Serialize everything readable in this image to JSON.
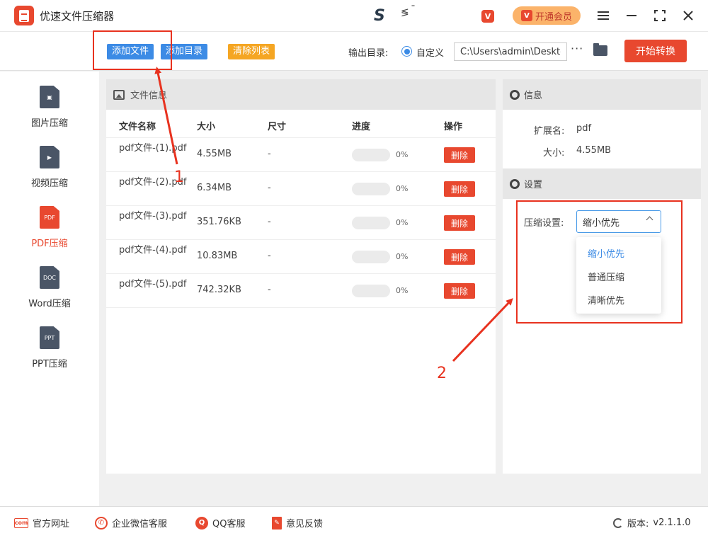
{
  "app": {
    "title": "优速文件压缩器",
    "vip_label": "开通会员",
    "vip_badge": "V",
    "window_controls": [
      "menu-icon",
      "minimize-icon",
      "fullscreen-icon",
      "close-icon"
    ],
    "mid_icons": {
      "s": "S",
      "a": "≶",
      "b": "¯"
    }
  },
  "toolbar": {
    "add_file": "添加文件",
    "add_dir": "添加目录",
    "clear_list": "清除列表",
    "output_label": "输出目录:",
    "radio_label": "自定义",
    "output_path": "C:\\Users\\admin\\Desktop",
    "more": "···",
    "start": "开始转换"
  },
  "sidebar": {
    "items": [
      {
        "label": "图片压缩",
        "icon": "image-icon",
        "glyph": "▣",
        "active": false
      },
      {
        "label": "视频压缩",
        "icon": "video-icon",
        "glyph": "▶",
        "active": false
      },
      {
        "label": "PDF压缩",
        "icon": "pdf-icon",
        "glyph": "PDF",
        "active": true
      },
      {
        "label": "Word压缩",
        "icon": "doc-icon",
        "glyph": "DOC",
        "active": false
      },
      {
        "label": "PPT压缩",
        "icon": "ppt-icon",
        "glyph": "PPT",
        "active": false
      }
    ]
  },
  "file_panel": {
    "title": "文件信息",
    "columns": [
      "文件名称",
      "大小",
      "尺寸",
      "进度",
      "操作"
    ],
    "rows": [
      {
        "name": "pdf文件-(1).pdf",
        "size": "4.55MB",
        "dim": "-",
        "progress": 0,
        "progress_text": "0%",
        "action": "删除"
      },
      {
        "name": "pdf文件-(2).pdf",
        "size": "6.34MB",
        "dim": "-",
        "progress": 0,
        "progress_text": "0%",
        "action": "删除"
      },
      {
        "name": "pdf文件-(3).pdf",
        "size": "351.76KB",
        "dim": "-",
        "progress": 0,
        "progress_text": "0%",
        "action": "删除"
      },
      {
        "name": "pdf文件-(4).pdf",
        "size": "10.83MB",
        "dim": "-",
        "progress": 0,
        "progress_text": "0%",
        "action": "删除"
      },
      {
        "name": "pdf文件-(5).pdf",
        "size": "742.32KB",
        "dim": "-",
        "progress": 0,
        "progress_text": "0%",
        "action": "删除"
      }
    ]
  },
  "info_panel": {
    "title": "信息",
    "ext_label": "扩展名:",
    "ext_value": "pdf",
    "size_label": "大小:",
    "size_value": "4.55MB"
  },
  "settings_panel": {
    "title": "设置",
    "compress_label": "压缩设置:",
    "selected": "缩小优先",
    "options": [
      "缩小优先",
      "普通压缩",
      "清晰优先"
    ]
  },
  "footer": {
    "items": [
      {
        "label": "官方网址",
        "icon": "website-icon",
        "glyph": "com"
      },
      {
        "label": "企业微信客服",
        "icon": "wechat-icon",
        "glyph": "✆"
      },
      {
        "label": "QQ客服",
        "icon": "qq-icon",
        "glyph": "Q"
      },
      {
        "label": "意见反馈",
        "icon": "feedback-icon",
        "glyph": "✎"
      }
    ],
    "version_label": "版本:",
    "version": "v2.1.1.0"
  },
  "annotations": {
    "num1": "1",
    "num2": "2"
  },
  "colors": {
    "accent": "#e8482f",
    "blue": "#3c8be5",
    "orange": "#f5a623",
    "annotation": "#e8321f"
  }
}
